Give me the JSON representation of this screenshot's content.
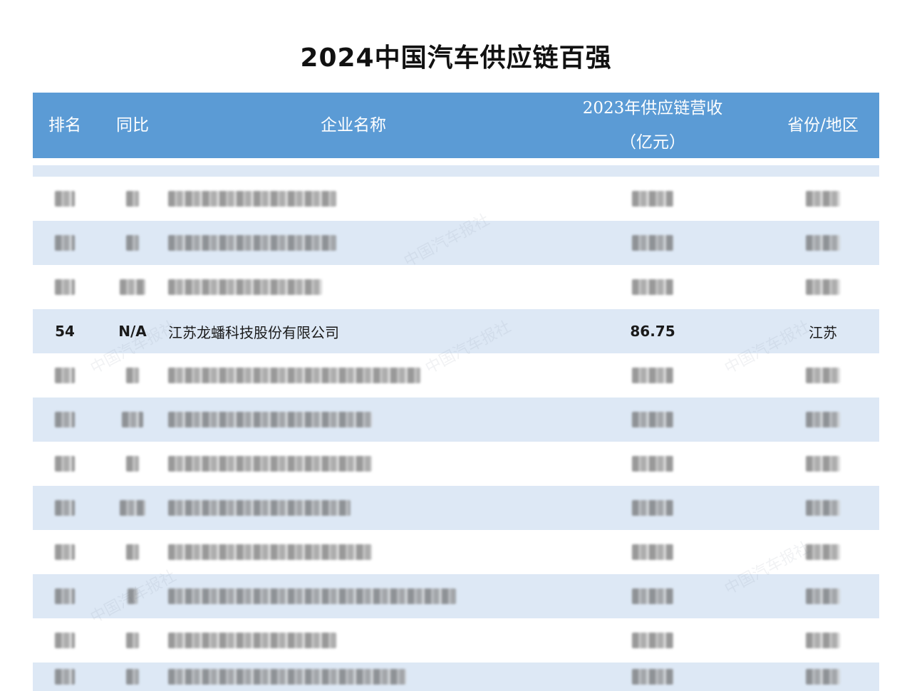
{
  "title": "2024中国汽车供应链百强",
  "header": {
    "rank": "排名",
    "yoy": "同比",
    "name": "企业名称",
    "revenue_line1": "2023年供应链营收",
    "revenue_line2": "（亿元）",
    "province": "省份/地区"
  },
  "highlight_row": {
    "rank": "54",
    "yoy": "N/A",
    "name": "江苏龙蟠科技股份有限公司",
    "revenue": "86.75",
    "province": "江苏"
  },
  "watermark_text": "中国汽车报社"
}
